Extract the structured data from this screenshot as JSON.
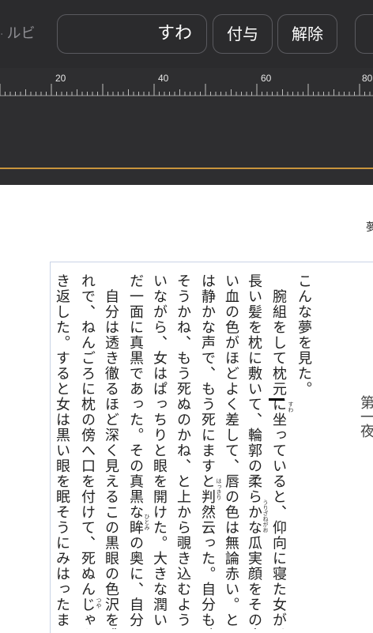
{
  "toolbar": {
    "ruby_label": "ルビ",
    "ruby_input_value": "すわ",
    "apply_label": "付与",
    "clear_label": "解除"
  },
  "ruler": {
    "ticks": [
      "20",
      "40",
      "60",
      "80"
    ]
  },
  "page": {
    "corner_text": "夢",
    "chapter_text": "第一夜",
    "columns": [
      "こんな夢を見た。",
      "　腕組をして枕元に坐っていると、仰向に寝た女が、",
      "長い髪を枕に敷いて、輪郭の柔らかな瓜実顔をその中",
      "い血の色がほどよく差して、唇の色は無論赤い。とう",
      "は静かな声で、もう死にますと判然云った。自分も確",
      "そうかね、もう死ぬのかね、と上から覗き込むように",
      "いながら、女はぱっちりと眼を開けた。大きな潤いの",
      "だ一面に真黒であった。その真黒な眸の奥に、自分の",
      "　自分は透き徹るほど深く見えるこの黒眼の色沢を眺",
      "れで、ねんごろに枕の傍へ口を付けて、死ぬんじゃな",
      "き返した。すると女は黒い眼を眠そうにみはったまま"
    ],
    "rubies": {
      "suwa": "すわ",
      "uriza": "うりざねがお",
      "hakkiri": "はっきり",
      "hitomi": "ひとみ",
      "tsuya": "つや"
    }
  }
}
